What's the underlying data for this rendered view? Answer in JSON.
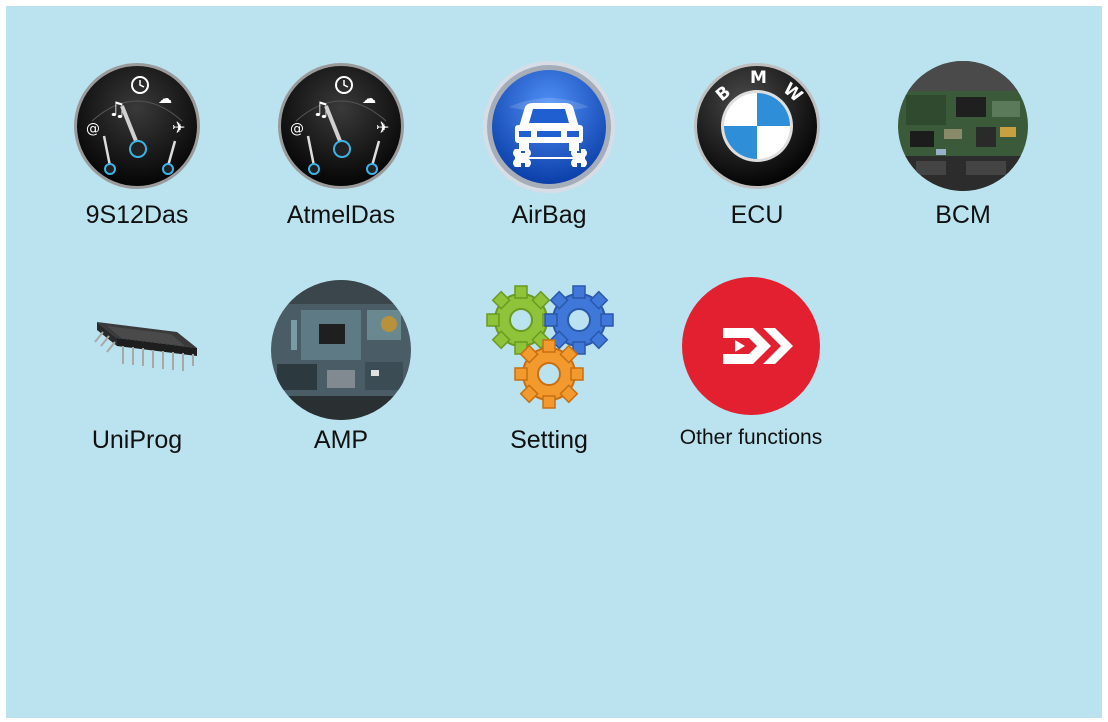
{
  "launcher": {
    "row1": [
      {
        "id": "9s12das",
        "label": "9S12Das",
        "icon": "dashboard-gauge-icon"
      },
      {
        "id": "atmeldas",
        "label": "AtmelDas",
        "icon": "dashboard-gauge-icon"
      },
      {
        "id": "airbag",
        "label": "AirBag",
        "icon": "car-service-icon"
      },
      {
        "id": "ecu",
        "label": "ECU",
        "icon": "bmw-logo-icon"
      },
      {
        "id": "bcm",
        "label": "BCM",
        "icon": "circuit-board-icon"
      }
    ],
    "row2": [
      {
        "id": "uniprog",
        "label": "UniProg",
        "icon": "microchip-icon"
      },
      {
        "id": "amp",
        "label": "AMP",
        "icon": "circuit-board-icon"
      },
      {
        "id": "setting",
        "label": "Setting",
        "icon": "gears-icon"
      },
      {
        "id": "other",
        "label": "Other functions",
        "icon": "arrow-logo-icon"
      }
    ],
    "bmw_letters": "BMW"
  },
  "colors": {
    "background": "#bae2ef",
    "airbag_blue": "#1f5fd0",
    "other_red": "#e2202f",
    "bmw_blue": "#2f8ed8"
  }
}
